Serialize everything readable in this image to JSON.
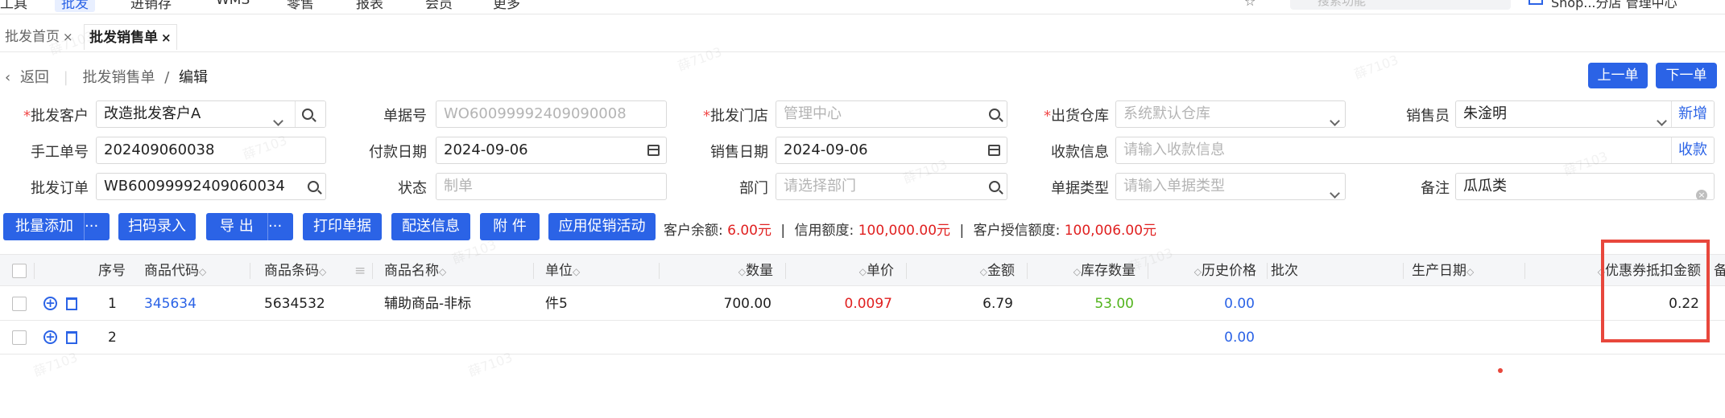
{
  "topnav": {
    "items": [
      "工具",
      "批发",
      "进销存",
      "WMS",
      "零售",
      "报表",
      "会员",
      "更多"
    ],
    "search_placeholder": "搜索功能",
    "user": "Shop...分店 管理中心"
  },
  "tabs": [
    {
      "label": "批发首页",
      "close": "×"
    },
    {
      "label": "批发销售单",
      "close": "×"
    }
  ],
  "breadcrumb": {
    "back": "返回",
    "parent": "批发销售单",
    "sep": "/",
    "current": "编辑"
  },
  "nav_buttons": {
    "prev": "上一单",
    "next": "下一单"
  },
  "form": {
    "customer_label": "批发客户",
    "customer_value": "改造批发客户A",
    "doc_no_label": "单据号",
    "doc_no_value": "WO60099992409090008",
    "store_label": "批发门店",
    "store_placeholder": "管理中心",
    "warehouse_label": "出货仓库",
    "warehouse_placeholder": "系统默认仓库",
    "salesman_label": "销售员",
    "salesman_value": "朱淦明",
    "salesman_link": "新增",
    "manual_no_label": "手工单号",
    "manual_no_value": "202409060038",
    "pay_date_label": "付款日期",
    "pay_date_value": "2024-09-06",
    "sale_date_label": "销售日期",
    "sale_date_value": "2024-09-06",
    "receipt_label": "收款信息",
    "receipt_placeholder": "请输入收款信息",
    "receipt_link": "收款",
    "order_label": "批发订单",
    "order_value": "WB60099992409060034",
    "status_label": "状态",
    "status_value": "制单",
    "dept_label": "部门",
    "dept_placeholder": "请选择部门",
    "doc_type_label": "单据类型",
    "doc_type_placeholder": "请输入单据类型",
    "remark_label": "备注",
    "remark_value": "瓜瓜类"
  },
  "toolbar": {
    "batch_add": "批量添加",
    "more": "···",
    "scan": "扫码录入",
    "export": "导 出",
    "print": "打印单据",
    "delivery": "配送信息",
    "attach": "附 件",
    "promo": "应用促销活动"
  },
  "balance": {
    "balance_label": "客户余额:",
    "balance_value": "6.00元",
    "sep": "|",
    "credit_label": "信用额度:",
    "credit_value": "100,000.00元",
    "grant_label": "客户授信额度:",
    "grant_value": "100,006.00元"
  },
  "table": {
    "columns": [
      "序号",
      "商品代码",
      "商品条码",
      "商品名称",
      "单位",
      "数量",
      "单价",
      "金额",
      "库存数量",
      "历史价格",
      "批次",
      "生产日期",
      "优惠券抵扣金额",
      "备"
    ],
    "rows": [
      {
        "seq": "1",
        "code": "345634",
        "barcode": "5634532",
        "name": "辅助商品-非标",
        "unit": "件5",
        "qty": "700.00",
        "price": "0.0097",
        "amount": "6.79",
        "stock": "53.00",
        "hist": "0.00",
        "coupon": "0.22"
      },
      {
        "seq": "2",
        "code": "",
        "barcode": "",
        "name": "",
        "unit": "",
        "qty": "",
        "price": "",
        "amount": "",
        "stock": "",
        "hist": "0.00",
        "coupon": ""
      }
    ]
  },
  "watermark": "薛7103",
  "colors": {
    "primary": "#2b63e6",
    "danger": "#e02020",
    "success": "#52b41d",
    "highlight": "#e8473c"
  }
}
